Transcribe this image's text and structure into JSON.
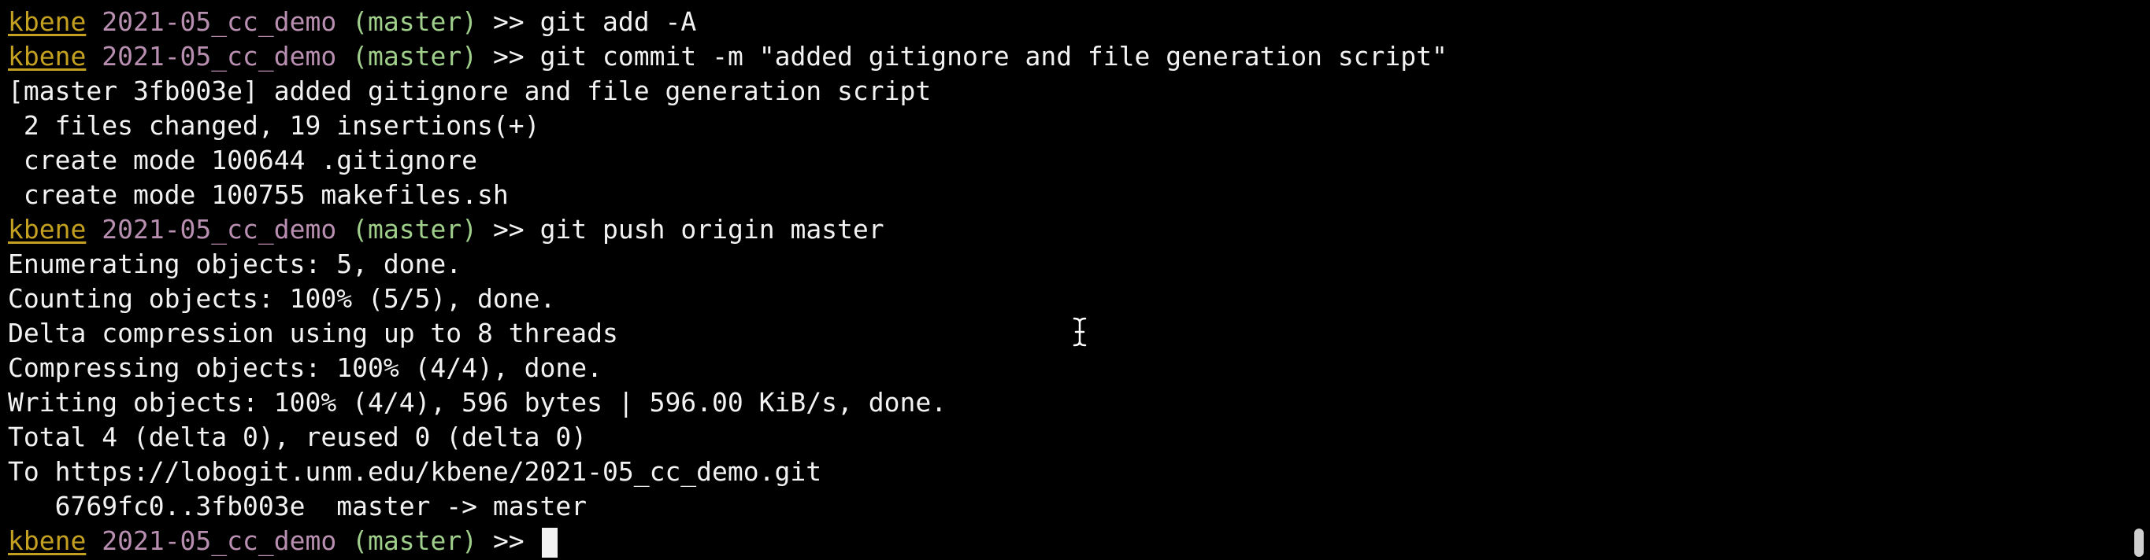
{
  "prompt": {
    "user": "kbene",
    "directory": "2021-05_cc_demo",
    "branch": "(master)",
    "symbol": ">>"
  },
  "colors": {
    "background": "#000000",
    "text": "#f2f2f2",
    "user": "#c4a020",
    "directory": "#b88fb0",
    "branch": "#9fcf8a"
  },
  "lines": [
    {
      "type": "prompt",
      "command": "git add -A"
    },
    {
      "type": "prompt",
      "command": "git commit -m \"added gitignore and file generation script\""
    },
    {
      "type": "output",
      "text": "[master 3fb003e] added gitignore and file generation script"
    },
    {
      "type": "output",
      "text": " 2 files changed, 19 insertions(+)"
    },
    {
      "type": "output",
      "text": " create mode 100644 .gitignore"
    },
    {
      "type": "output",
      "text": " create mode 100755 makefiles.sh"
    },
    {
      "type": "prompt",
      "command": "git push origin master"
    },
    {
      "type": "output",
      "text": "Enumerating objects: 5, done."
    },
    {
      "type": "output",
      "text": "Counting objects: 100% (5/5), done."
    },
    {
      "type": "output",
      "text": "Delta compression using up to 8 threads"
    },
    {
      "type": "output",
      "text": "Compressing objects: 100% (4/4), done."
    },
    {
      "type": "output",
      "text": "Writing objects: 100% (4/4), 596 bytes | 596.00 KiB/s, done."
    },
    {
      "type": "output",
      "text": "Total 4 (delta 0), reused 0 (delta 0)"
    },
    {
      "type": "output",
      "text": "To https://lobogit.unm.edu/kbene/2021-05_cc_demo.git"
    },
    {
      "type": "output",
      "text": "   6769fc0..3fb003e  master -> master"
    },
    {
      "type": "prompt",
      "command": "",
      "active": true
    }
  ],
  "icons": {
    "mouse_cursor": "text-cursor-icon"
  }
}
